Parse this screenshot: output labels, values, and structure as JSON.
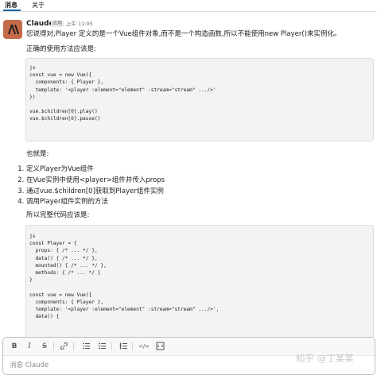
{
  "tabs": [
    {
      "label": "消息",
      "active": true
    },
    {
      "label": "关于",
      "active": false
    }
  ],
  "message": {
    "author": "Claude",
    "badge": "应用",
    "time": "上午 11:05",
    "avatar_icon": "anthropic-logo-icon",
    "avatar_color": "#c46a4b",
    "intro": "您说得对,Player 定义的是一个Vue组件对象,而不是一个构造函数,所以不能使用new Player()来实例化。",
    "correct_usage_label": "正确的使用方法应该是:",
    "code_block_1": "js\nconst vue = new Vue({\n  components: { Player },\n  template: '<player :element=\"element\" :stream=\"stream\" .../>'\n})\n\nvue.$children[0].play()\nvue.$children[0].pause()",
    "that_is_label": "也就是:",
    "steps": [
      "定义Player为Vue组件",
      "在Vue实例中使用<player>组件并传入props",
      "通过vue.$children[0]获取到Player组件实例",
      "调用Player组件实例的方法"
    ],
    "full_code_label": "所以完整代码应该是:",
    "code_block_2": "js\nconst Player = {\n  props: { /* ... */ },\n  data() { /* ... */ },\n  mounted() { /* ... */ },\n  methods: { /* ... */ }\n}\n\nconst vue = new Vue({\n  components: { Player },\n  template: '<player :element=\"element\" :stream=\"stream\" .../>',\n  data() {"
  },
  "composer": {
    "placeholder": "消息 Claude",
    "tools": [
      {
        "icon": "bold-icon",
        "glyph": "B"
      },
      {
        "icon": "italic-icon",
        "glyph": "I"
      },
      {
        "icon": "strikethrough-icon",
        "glyph": "S"
      },
      {
        "icon": "link-icon",
        "glyph": "🔗"
      },
      {
        "icon": "numbered-list-icon",
        "glyph": "≔"
      },
      {
        "icon": "bulleted-list-icon",
        "glyph": "☰"
      },
      {
        "icon": "blockquote-icon",
        "glyph": "▍"
      },
      {
        "icon": "code-icon",
        "glyph": "</>"
      },
      {
        "icon": "code-block-icon",
        "glyph": "▤"
      }
    ]
  },
  "watermark": "知乎 @丁某某"
}
